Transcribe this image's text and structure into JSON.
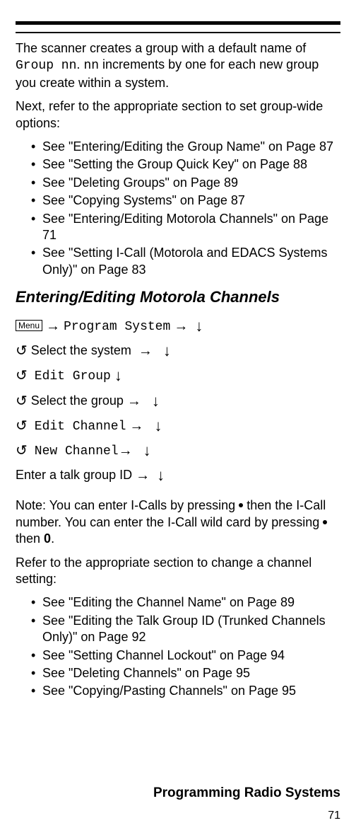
{
  "intro": {
    "p1a": "The scanner creates a group with a default name of ",
    "p1_mono": "Group nn",
    "p1b": ". ",
    "p1_mono2": "nn",
    "p1c": " increments by one for each new group you create within a system.",
    "p2": "Next, refer to the appropriate section to set group-wide options:"
  },
  "bullets1": [
    "See \"Entering/Editing the Group Name\" on Page 87",
    "See \"Setting the Group Quick Key\" on Page 88",
    "See \"Deleting Groups\" on Page 89",
    "See \"Copying Systems\" on Page 87",
    "See \"Entering/Editing Motorola Channels\" on Page 71",
    "See \"Setting I-Call (Motorola and EDACS Systems Only)\" on Page 83"
  ],
  "heading": "Entering/Editing Motorola Channels",
  "nav": {
    "menu_label": "Menu",
    "program_system": "Program System",
    "select_system": "Select the system",
    "edit_group": "Edit Group",
    "select_group": "Select the group",
    "edit_channel": "Edit Channel",
    "new_channel": "New Channel",
    "enter_tgid": "Enter a talk group ID"
  },
  "note": {
    "a": "Note: You can enter I-Calls by pressing ",
    "b": " then the I-Call number.  You can enter the I-Call wild card by pressing ",
    "c": " then ",
    "zero": "0",
    "d": "."
  },
  "refer": "Refer to the appropriate section to change a channel setting:",
  "bullets2": [
    "See \"Editing the Channel Name\" on Page 89",
    "See \"Editing the Talk Group ID (Trunked Channels Only)\" on Page 92",
    "See \"Setting Channel Lockout\" on Page 94",
    "See \"Deleting Channels\" on Page 95",
    "See \"Copying/Pasting Channels\" on Page 95"
  ],
  "footer": "Programming Radio Systems",
  "page_number": "71"
}
